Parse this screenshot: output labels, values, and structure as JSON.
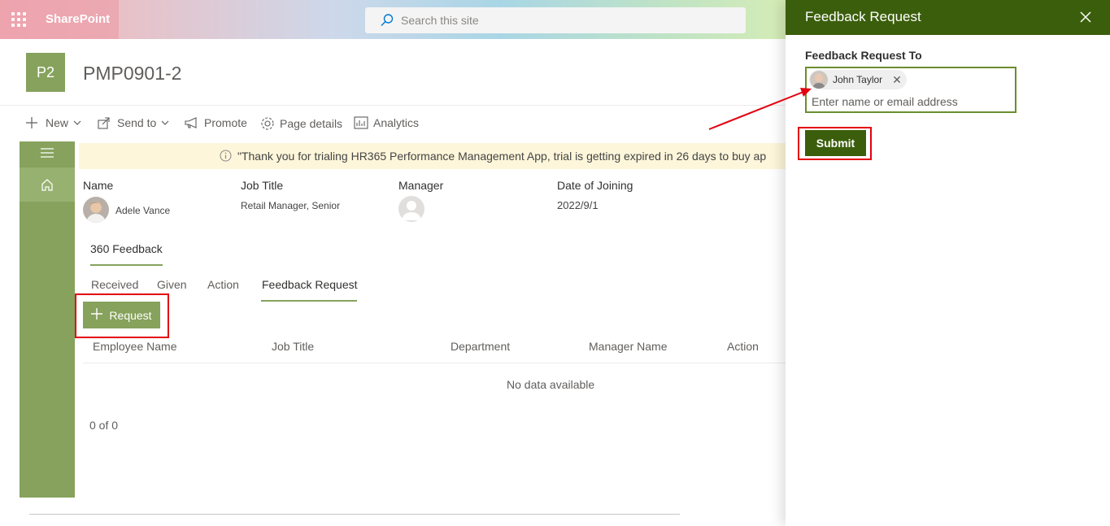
{
  "suite_bar": {
    "app_name": "SharePoint",
    "search_placeholder": "Search this site"
  },
  "site": {
    "logo_text": "P2",
    "title": "PMP0901-2"
  },
  "command_bar": {
    "new": "New",
    "send_to": "Send to",
    "promote": "Promote",
    "page_details": "Page details",
    "analytics": "Analytics"
  },
  "banner": {
    "text": "\"Thank you for trialing HR365 Performance Management App, trial is getting expired in 26 days to buy ap"
  },
  "profile": {
    "name_label": "Name",
    "name_value": "Adele Vance",
    "job_title_label": "Job Title",
    "job_title_value": "Retail Manager, Senior",
    "manager_label": "Manager",
    "doj_label": "Date of Joining",
    "doj_value": "2022/9/1"
  },
  "tabs": {
    "main": "360 Feedback",
    "sub": [
      "Received",
      "Given",
      "Action",
      "Feedback Request"
    ]
  },
  "request_button": "Request",
  "table": {
    "columns": [
      "Employee Name",
      "Job Title",
      "Department",
      "Manager Name",
      "Action"
    ],
    "empty_text": "No data available",
    "pager": "0 of 0"
  },
  "panel": {
    "title": "Feedback Request",
    "field_label": "Feedback Request To",
    "selected_person": "John Taylor",
    "input_placeholder": "Enter name or email address",
    "submit": "Submit"
  },
  "colors": {
    "accent_green": "#86a25c",
    "panel_green": "#3b5e0c",
    "highlight_red": "#e3000f"
  }
}
